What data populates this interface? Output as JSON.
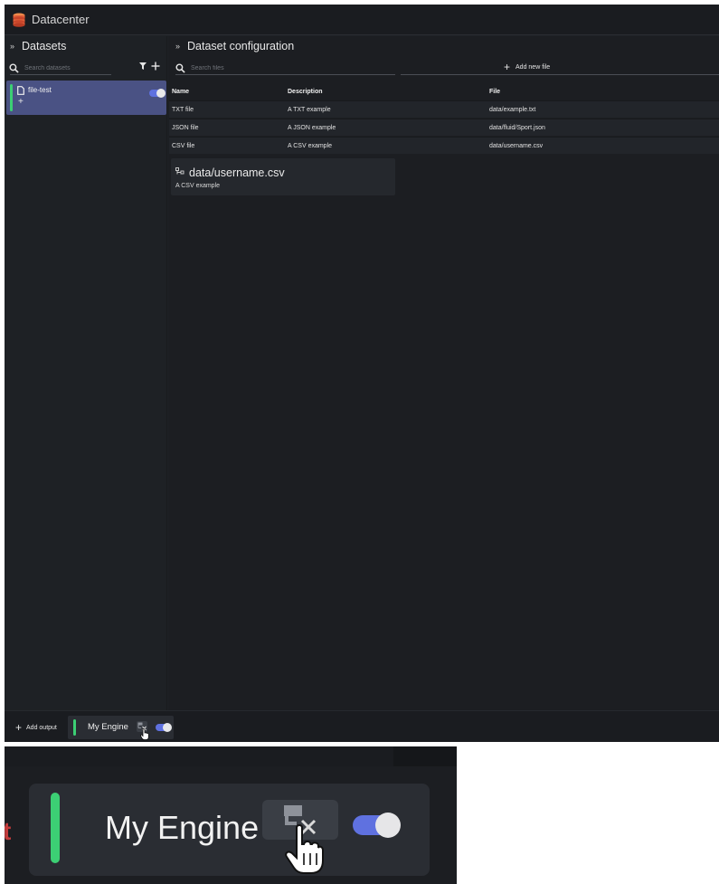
{
  "app": {
    "title": "Datacenter",
    "logo_icon": "database-stack-icon",
    "colors": {
      "background": "#1e2125",
      "selected": "#4a5284",
      "accent_green": "#3ccf74",
      "toggle_on": "#5f71e0",
      "logo": "#e0623a"
    }
  },
  "datasets_panel": {
    "title": "Datasets",
    "search_placeholder": "Search datasets",
    "items": [
      {
        "name": "file-test",
        "enabled": true,
        "add_label": "+"
      }
    ]
  },
  "config_panel": {
    "title": "Dataset configuration",
    "search_placeholder": "Search files",
    "add_file_label": "Add new file",
    "columns": [
      "Name",
      "Description",
      "File"
    ],
    "rows": [
      {
        "name": "TXT file",
        "description": "A TXT example",
        "file": "data/example.txt"
      },
      {
        "name": "JSON file",
        "description": "A JSON example",
        "file": "data/fluid/Sport.json"
      },
      {
        "name": "CSV file",
        "description": "A CSV example",
        "file": "data/username.csv"
      }
    ],
    "preview": {
      "path": "data/username.csv",
      "description": "A CSV example"
    }
  },
  "bottom_bar": {
    "add_output_label": "Add output",
    "engine": {
      "label": "My Engine",
      "enabled": true
    }
  },
  "zoom_inset": {
    "engine_label": "My Engine",
    "edge_char": "t"
  }
}
